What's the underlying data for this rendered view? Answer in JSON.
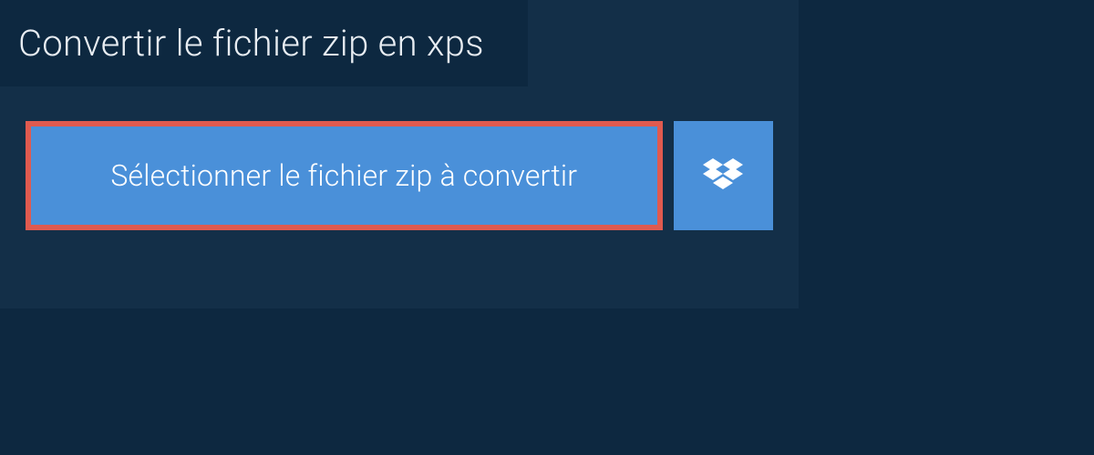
{
  "title": "Convertir le fichier zip en xps",
  "buttons": {
    "select_label": "Sélectionner le fichier zip à convertir"
  },
  "colors": {
    "background": "#0d2840",
    "panel": "#132f48",
    "button": "#4a90d9",
    "highlight_border": "#e05a4f",
    "text_light": "#e8edf2",
    "text_white": "#ffffff"
  }
}
